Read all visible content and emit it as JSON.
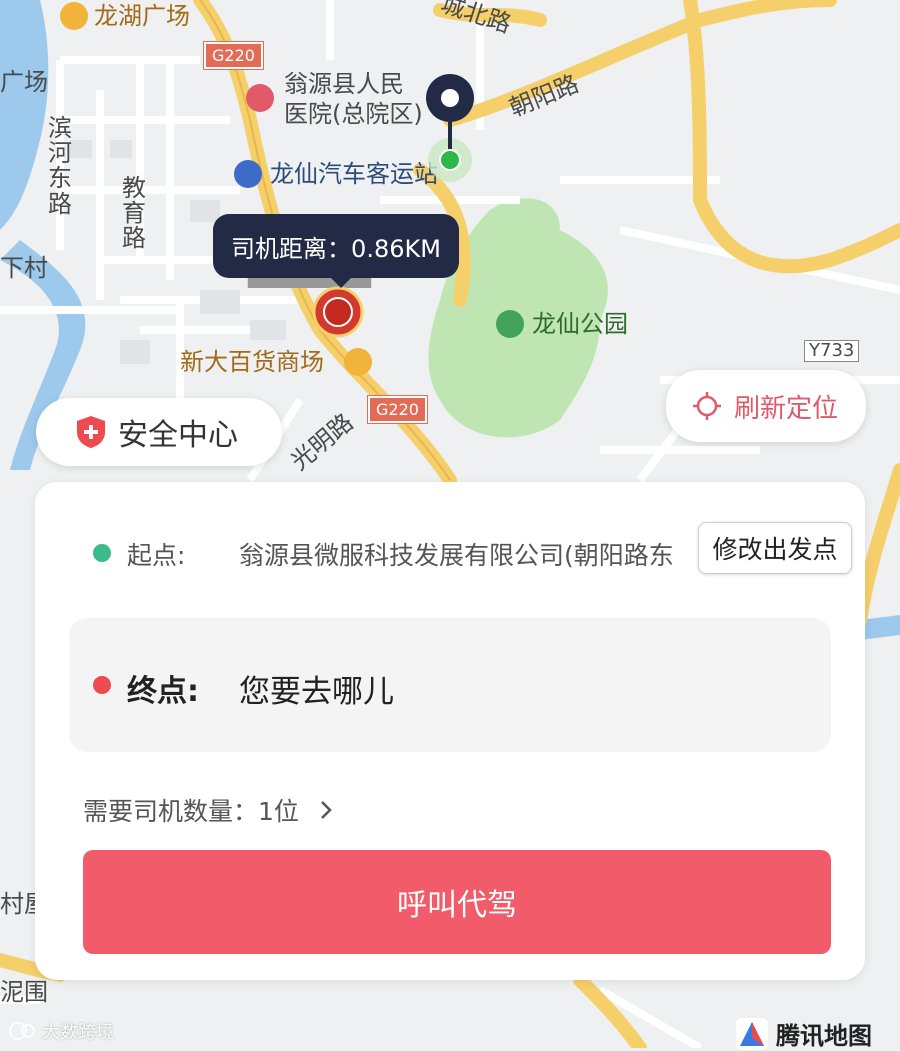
{
  "map": {
    "labels": {
      "longhu_plaza": "龙湖广场",
      "guang_chang": "广场",
      "binhe_road": "滨河东路",
      "jiaoyu_road": "教育路",
      "xia_cun": "下村",
      "hospital_line1": "翁源县人民",
      "hospital_line2": "医院(总院区)",
      "bus_station": "龙仙汽车客运站",
      "chengbei_road": "城北路",
      "chaoyang_road": "朝阳路",
      "park": "龙仙公园",
      "department_store": "新大百货商场",
      "guangming_road": "光明路",
      "cun_wu": "村屋",
      "ni_wei": "泥围",
      "g220_top": "G220",
      "g220_bottom": "G220",
      "y733": "Y733",
      "poi_hidden": "▇▇▇▇▇▇▇▇"
    },
    "driver_distance": "司机距离：0.86KM",
    "watermark": "大数跨境",
    "provider": "腾讯地图"
  },
  "safety_center": {
    "label": "安全中心",
    "icon": "shield-plus-icon"
  },
  "refresh_location": {
    "label": "刷新定位",
    "icon": "crosshair-icon"
  },
  "trip": {
    "start_label": "起点:",
    "start_value": "翁源县微服科技发展有限公司(朝阳路东",
    "modify_button": "修改出发点",
    "end_label": "终点:",
    "end_placeholder": "您要去哪儿",
    "drivers_label": "需要司机数量：1位",
    "call_button": "呼叫代驾"
  },
  "colors": {
    "start_dot": "#3dba8c",
    "end_dot": "#ee4b50",
    "accent": "#f25c6a",
    "tooltip_bg": "#232a45",
    "road_yellow": "#f5cf6a",
    "water": "#9cc9ec",
    "park_green": "#bfe6b2"
  }
}
